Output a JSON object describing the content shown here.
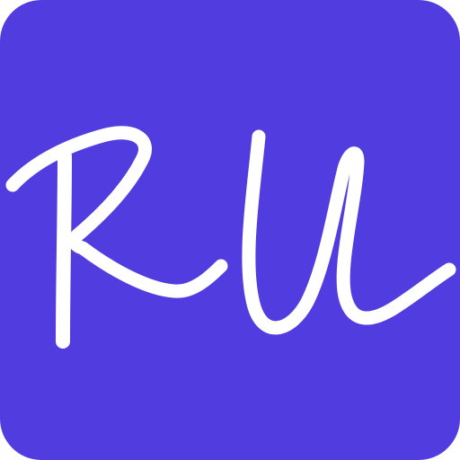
{
  "icon": {
    "monogram": "RU",
    "background_color": "#513DDF",
    "letter_color": "#FFFFFF",
    "page_background": "#FFFFFF"
  }
}
